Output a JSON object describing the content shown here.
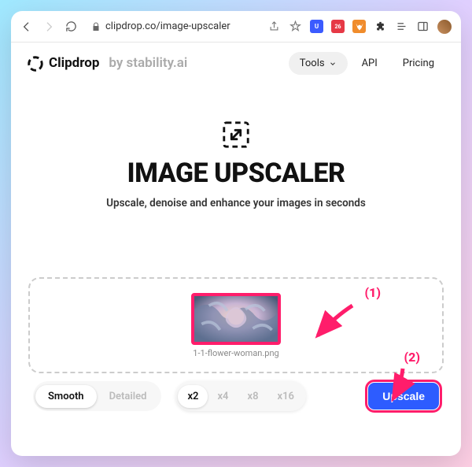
{
  "browser": {
    "url_display": "clipdrop.co/image-upscaler"
  },
  "nav": {
    "brand": "Clipdrop",
    "sub_brand": "by stability.ai",
    "tools_label": "Tools",
    "api_label": "API",
    "pricing_label": "Pricing"
  },
  "hero": {
    "title": "IMAGE UPSCALER",
    "subtitle": "Upscale, denoise and enhance your images in seconds"
  },
  "dropzone": {
    "filename": "1-1-flower-woman.png"
  },
  "controls": {
    "mode": {
      "options": [
        "Smooth",
        "Detailed"
      ],
      "active": "Smooth"
    },
    "scale": {
      "options": [
        "x2",
        "x4",
        "x8",
        "x16"
      ],
      "active": "x2"
    },
    "action_label": "Upscale"
  },
  "annotations": {
    "one": "(1)",
    "two": "(2)"
  }
}
